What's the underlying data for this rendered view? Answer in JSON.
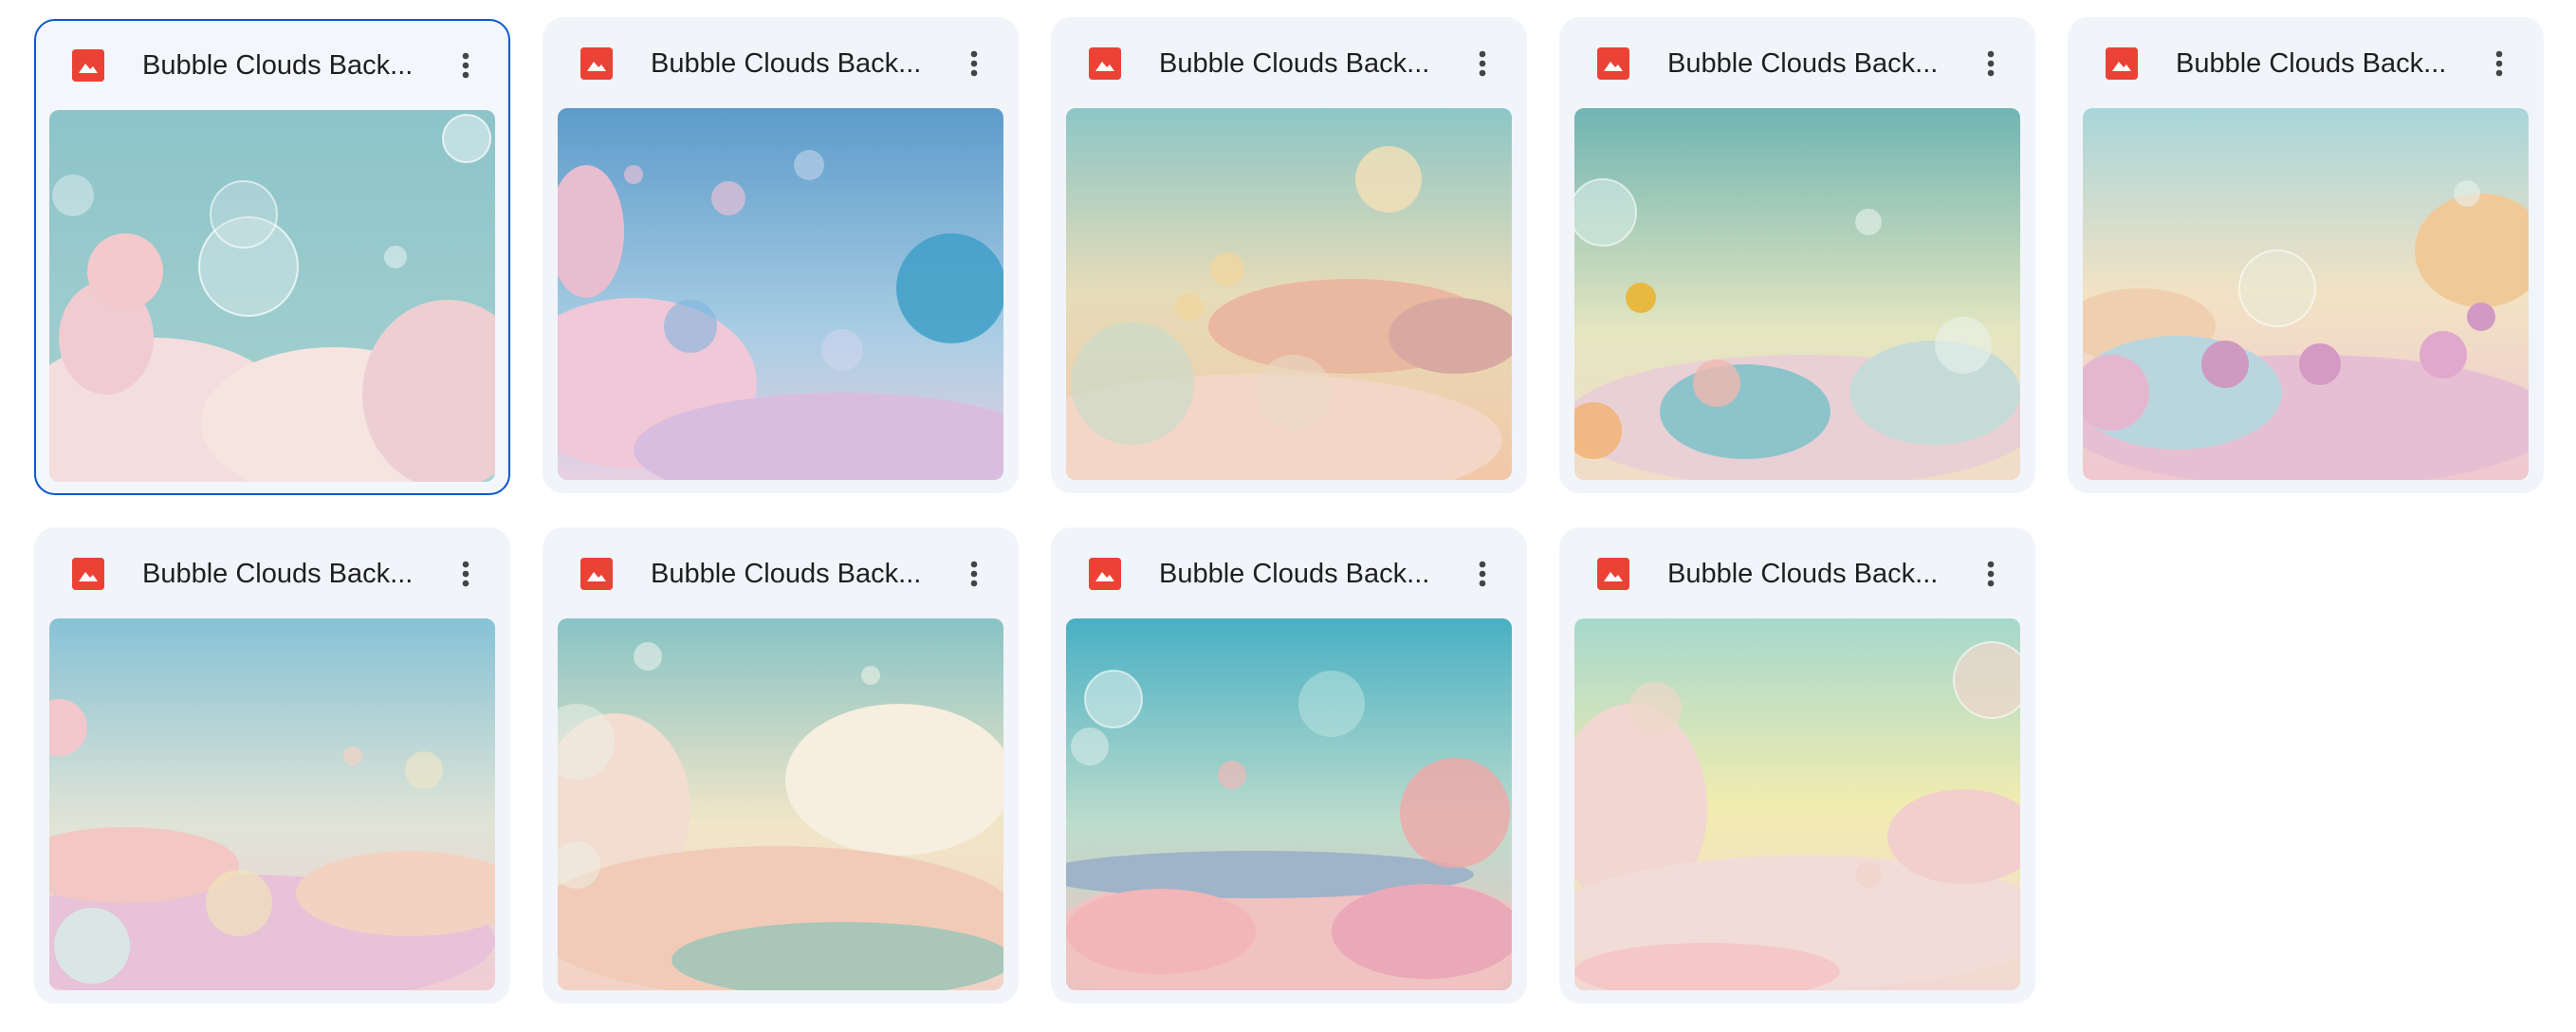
{
  "files": [
    {
      "title": "Bubble Clouds Back...",
      "icon": "image-file-icon",
      "selected": true
    },
    {
      "title": "Bubble Clouds Back...",
      "icon": "image-file-icon",
      "selected": false
    },
    {
      "title": "Bubble Clouds Back...",
      "icon": "image-file-icon",
      "selected": false
    },
    {
      "title": "Bubble Clouds Back...",
      "icon": "image-file-icon",
      "selected": false
    },
    {
      "title": "Bubble Clouds Back...",
      "icon": "image-file-icon",
      "selected": false
    },
    {
      "title": "Bubble Clouds Back...",
      "icon": "image-file-icon",
      "selected": false
    },
    {
      "title": "Bubble Clouds Back...",
      "icon": "image-file-icon",
      "selected": false
    },
    {
      "title": "Bubble Clouds Back...",
      "icon": "image-file-icon",
      "selected": false
    },
    {
      "title": "Bubble Clouds Back...",
      "icon": "image-file-icon",
      "selected": false
    }
  ],
  "colors": {
    "card_bg": "#f1f4f9",
    "selected_border": "#0b57d0",
    "image_icon": "#ea4335",
    "title_text": "#1f1f1f"
  },
  "more_icon": "more-vert-icon"
}
